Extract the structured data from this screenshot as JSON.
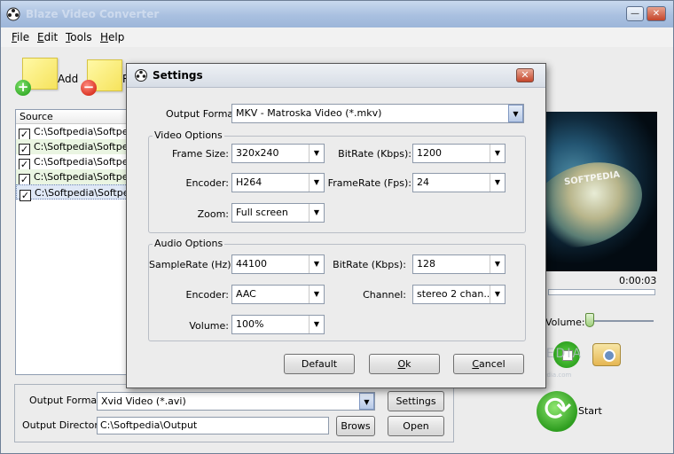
{
  "main_window": {
    "title": "Blaze Video Converter",
    "minimize_glyph": "—",
    "close_glyph": "✕"
  },
  "menu": [
    {
      "label": "File",
      "key": "F",
      "rest": "ile"
    },
    {
      "label": "Edit",
      "key": "E",
      "rest": "dit"
    },
    {
      "label": "Tools",
      "key": "T",
      "rest": "ools"
    },
    {
      "label": "Help",
      "key": "H",
      "rest": "elp"
    }
  ],
  "toolbar": {
    "add_label": "Add",
    "remove_label_partial": "R"
  },
  "source_list": {
    "header": "Source",
    "rows": [
      {
        "text": "C:\\Softpedia\\Softpedi",
        "checked": true
      },
      {
        "text": "C:\\Softpedia\\Softpedi",
        "checked": true
      },
      {
        "text": "C:\\Softpedia\\Softpedi",
        "checked": true
      },
      {
        "text": "C:\\Softpedia\\Softpedi",
        "checked": true
      },
      {
        "text": "C:\\Softpedia\\Softpedi",
        "checked": true
      }
    ]
  },
  "preview": {
    "time": "0:00:03",
    "volume_label": "Volume:",
    "volume_level": 0.05,
    "start_label": "Start",
    "video_watermark": "SOFTPEDIA",
    "watermark_main": "SOFTPEDIA",
    "watermark_sub": "www.softpedia.com"
  },
  "bottom": {
    "output_format_label": "Output Format:",
    "output_format_value": "Xvid Video (*.avi)",
    "settings_button": "Settings",
    "output_directory_label": "Output Directory:",
    "output_directory_value": "C:\\Softpedia\\Output",
    "browse_button": "Brows",
    "open_button": "Open"
  },
  "settings_dialog": {
    "title": "Settings",
    "close_glyph": "✕",
    "output_format_label": "Output Format:",
    "output_format_value": "MKV - Matroska Video (*.mkv)",
    "video_options": {
      "group_title": "Video Options",
      "frame_size_label": "Frame Size:",
      "frame_size_value": "320x240",
      "bitrate_label": "BitRate (Kbps):",
      "bitrate_value": "1200",
      "encoder_label": "Encoder:",
      "encoder_value": "H264",
      "framerate_label": "FrameRate (Fps):",
      "framerate_value": "24",
      "zoom_label": "Zoom:",
      "zoom_value": "Full screen"
    },
    "audio_options": {
      "group_title": "Audio Options",
      "samplerate_label": "SampleRate (Hz):",
      "samplerate_value": "44100",
      "bitrate_label": "BitRate (Kbps):",
      "bitrate_value": "128",
      "encoder_label": "Encoder:",
      "encoder_value": "AAC",
      "channel_label": "Channel:",
      "channel_value": "stereo 2 chan...",
      "volume_label": "Volume:",
      "volume_value": "100%"
    },
    "buttons": {
      "default": "Default",
      "ok_key": "O",
      "ok_rest": "k",
      "cancel_key": "C",
      "cancel_rest": "ancel"
    }
  },
  "colors": {
    "title_gradient_top": "#c9d9ee",
    "close_red": "#c4452a",
    "note_yellow": "#fff9a6",
    "green_accent": "#2e9d1f"
  }
}
